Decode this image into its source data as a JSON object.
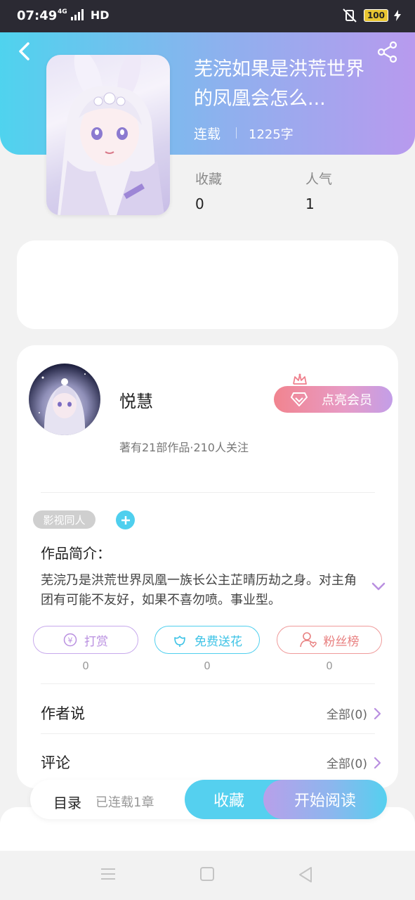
{
  "status_bar": {
    "time": "07:49",
    "network": "4G",
    "hd": "HD",
    "battery": "100"
  },
  "book": {
    "title": "芜浣如果是洪荒世界的凤凰会怎么...",
    "status": "连载",
    "word_count": "1225字",
    "stats": [
      {
        "label": "收藏",
        "value": "0"
      },
      {
        "label": "人气",
        "value": "1"
      }
    ]
  },
  "author": {
    "name": "悦慧",
    "meta": "著有21部作品·210人关注",
    "vip_label": "点亮会员"
  },
  "tags": [
    "影视同人"
  ],
  "intro": {
    "title": "作品简介：",
    "text": "芜浣乃是洪荒世界凤凰一族长公主芷晴历劫之身。对主角团有可能不友好，如果不喜勿喷。事业型。"
  },
  "actions": [
    {
      "label": "打赏",
      "count": "0",
      "color": "#b98fe0"
    },
    {
      "label": "免费送花",
      "count": "0",
      "color": "#4fcfee"
    },
    {
      "label": "粉丝榜",
      "count": "0",
      "color": "#ee8a8a"
    }
  ],
  "author_says": {
    "label": "作者说",
    "link": "全部(0)"
  },
  "comments": {
    "label": "评论",
    "link": "全部(0)"
  },
  "bottom_bar": {
    "toc_label": "目录",
    "toc_meta": "已连载1章",
    "favorite_label": "收藏",
    "read_label": "开始阅读"
  },
  "colors": {
    "accent_cyan": "#55d0ef",
    "accent_purple": "#b89aee",
    "vip_pink": "#f1848f"
  }
}
